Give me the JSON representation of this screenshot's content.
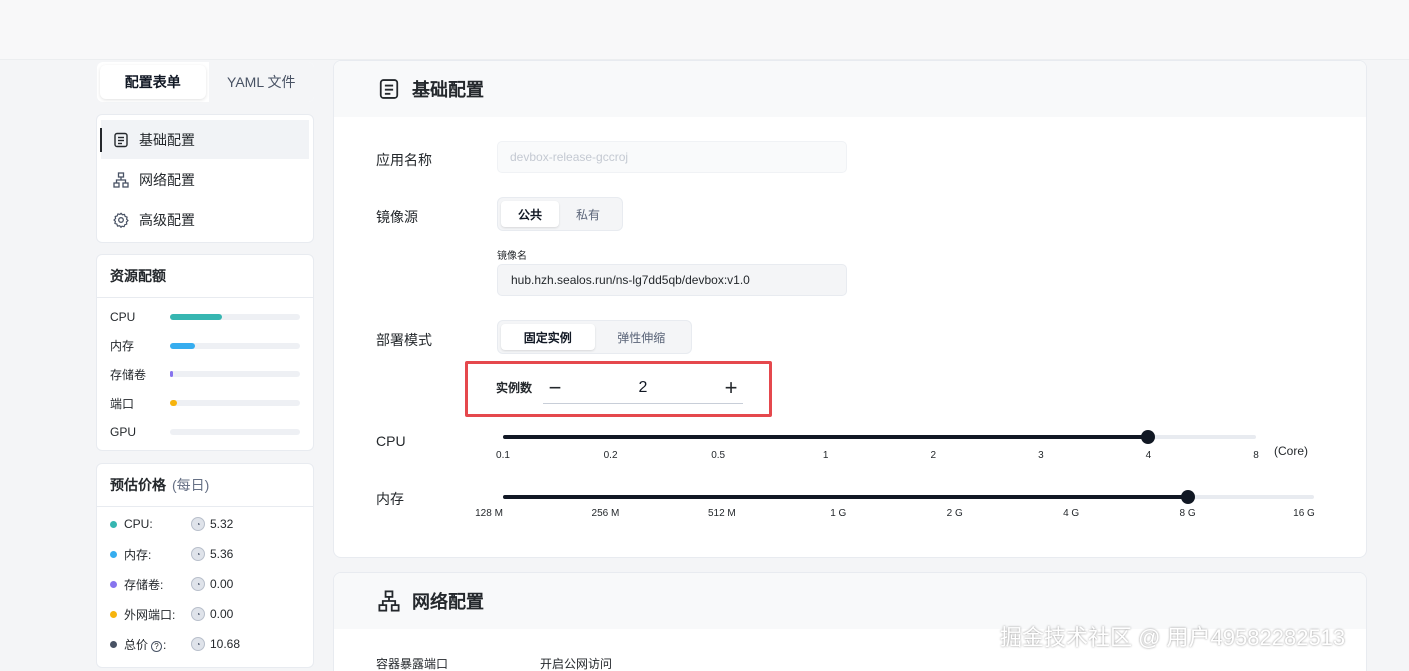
{
  "tabs": {
    "form": "配置表单",
    "yaml": "YAML 文件"
  },
  "nav": {
    "items": [
      {
        "label": "基础配置",
        "icon": "document-icon"
      },
      {
        "label": "网络配置",
        "icon": "network-icon"
      },
      {
        "label": "高级配置",
        "icon": "gear-icon"
      }
    ]
  },
  "resources": {
    "title": "资源配额",
    "items": [
      {
        "label": "CPU",
        "fraction": 0.4,
        "color": "#36b6b1"
      },
      {
        "label": "内存",
        "fraction": 0.19,
        "color": "#36adef"
      },
      {
        "label": "存储卷",
        "fraction": 0.02,
        "color": "#8774ee"
      },
      {
        "label": "端口",
        "fraction": 0.05,
        "color": "#f6b40e"
      },
      {
        "label": "GPU",
        "fraction": 0,
        "color": "#a0a7b4"
      }
    ]
  },
  "price": {
    "title": "预估价格",
    "subtitle": "(每日)",
    "items": [
      {
        "label": "CPU:",
        "value": "5.32",
        "color": "#36b6b1"
      },
      {
        "label": "内存:",
        "value": "5.36",
        "color": "#36adef"
      },
      {
        "label": "存储卷:",
        "value": "0.00",
        "color": "#8774ee"
      },
      {
        "label": "外网端口:",
        "value": "0.00",
        "color": "#f6b40e"
      },
      {
        "label": "总价",
        "value": "10.68",
        "color": "#485264"
      }
    ]
  },
  "basic": {
    "title": "基础配置",
    "app_name_label": "应用名称",
    "app_name_placeholder": "devbox-release-gccroj",
    "image_source_label": "镜像源",
    "image_source_options": [
      "公共",
      "私有"
    ],
    "image_name_label": "镜像名",
    "image_name_value": "hub.hzh.sealos.run/ns-lg7dd5qb/devbox:v1.0",
    "deploy_mode_label": "部署模式",
    "deploy_mode_options": [
      "固定实例",
      "弹性伸缩"
    ],
    "instances_label": "实例数",
    "instances_value": "2",
    "minus": "−",
    "plus": "+",
    "cpu_label": "CPU",
    "cpu_ticks": [
      "0.1",
      "0.2",
      "0.5",
      "1",
      "2",
      "3",
      "4",
      "8"
    ],
    "cpu_unit": "(Core)",
    "cpu_selected_index": 6,
    "mem_label": "内存",
    "mem_ticks": [
      "128 M",
      "256 M",
      "512 M",
      "1 G",
      "2 G",
      "4 G",
      "8 G",
      "16 G"
    ],
    "mem_selected_index": 6
  },
  "network": {
    "title": "网络配置",
    "port_label": "容器暴露端口",
    "public_label": "开启公网访问"
  },
  "watermark": "掘金技术社区 @ 用户49582282513"
}
